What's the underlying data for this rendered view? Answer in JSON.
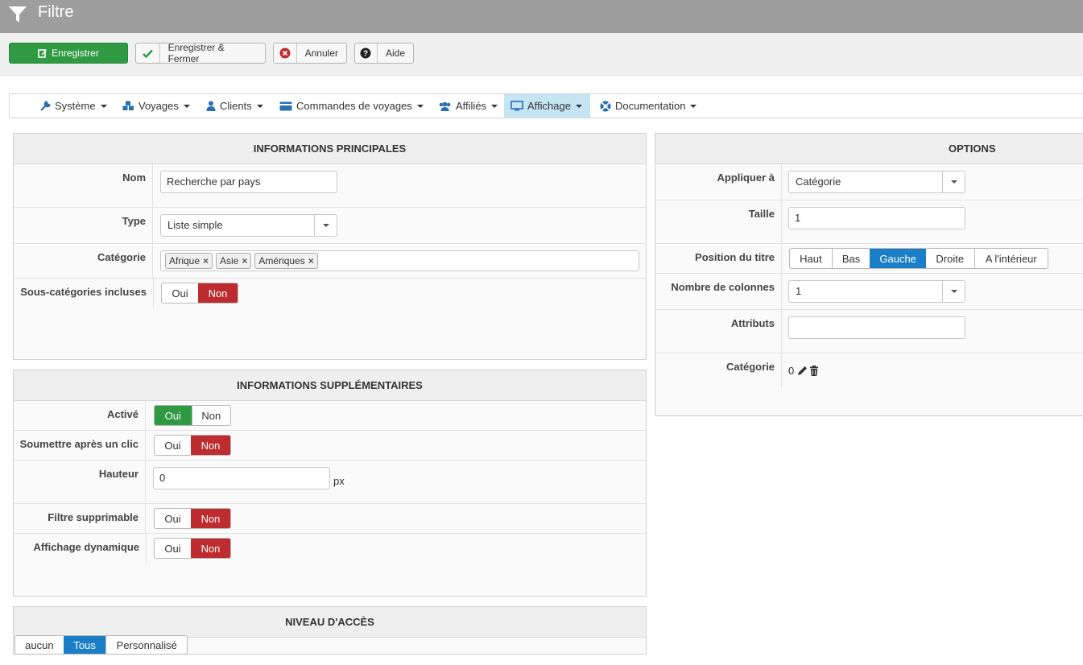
{
  "header": {
    "title": "Filtre"
  },
  "toolbar": {
    "save_label": "Enregistrer",
    "save_close_label": "Enregistrer & Fermer",
    "cancel_label": "Annuler",
    "help_label": "Aide"
  },
  "menu": {
    "items": [
      {
        "label": "Système",
        "icon": "wrench-icon"
      },
      {
        "label": "Voyages",
        "icon": "cubes-icon"
      },
      {
        "label": "Clients",
        "icon": "user-icon"
      },
      {
        "label": "Commandes de voyages",
        "icon": "credit-card-icon"
      },
      {
        "label": "Affiliés",
        "icon": "users-icon"
      },
      {
        "label": "Affichage",
        "icon": "monitor-icon",
        "active": true
      },
      {
        "label": "Documentation",
        "icon": "lifebuoy-icon"
      }
    ]
  },
  "main_info": {
    "title": "INFORMATIONS PRINCIPALES",
    "name_label": "Nom",
    "name_value": "Recherche par pays",
    "type_label": "Type",
    "type_value": "Liste simple",
    "category_label": "Catégorie",
    "category_tags": [
      "Afrique",
      "Asie",
      "Amériques"
    ],
    "subcat_label": "Sous-catégories incluses",
    "yes": "Oui",
    "no": "Non"
  },
  "extra_info": {
    "title": "INFORMATIONS SUPPLÉMENTAIRES",
    "active_label": "Activé",
    "submit_label": "Soumettre après un clic",
    "height_label": "Hauteur",
    "height_value": "0",
    "height_unit": "px",
    "removable_label": "Filtre supprimable",
    "dynamic_label": "Affichage dynamique",
    "yes": "Oui",
    "no": "Non"
  },
  "access": {
    "title": "NIVEAU D'ACCÈS",
    "options": [
      "aucun",
      "Tous",
      "Personnalisé"
    ],
    "selected": "Tous"
  },
  "options": {
    "title": "OPTIONS",
    "apply_label": "Appliquer à",
    "apply_value": "Catégorie",
    "size_label": "Taille",
    "size_value": "1",
    "title_pos_label": "Position du titre",
    "title_pos_options": [
      "Haut",
      "Bas",
      "Gauche",
      "Droite",
      "A l'intérieur"
    ],
    "title_pos_selected": "Gauche",
    "columns_label": "Nombre de colonnes",
    "columns_value": "1",
    "attributes_label": "Attributs",
    "attributes_value": "",
    "category_label": "Catégorie",
    "category_value": "0"
  },
  "colors": {
    "header_bg": "#9e9e9e",
    "save_green": "#2f9a42",
    "no_red": "#bd2c2f",
    "selected_blue": "#1a7fc6",
    "menu_active": "#c5e5f3"
  }
}
